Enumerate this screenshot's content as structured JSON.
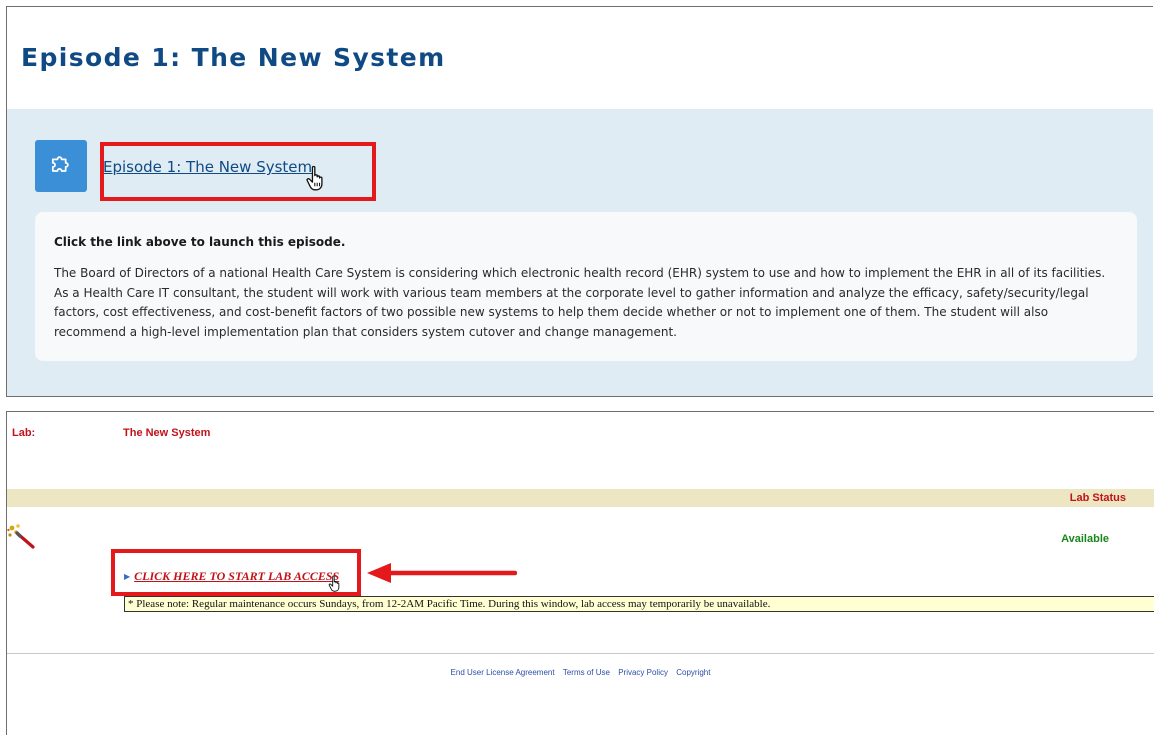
{
  "episode": {
    "title": "Episode 1: The New System",
    "activity_link": "Episode 1: The New System",
    "icon": "puzzle-icon",
    "instruction": "Click the link above to launch this episode.",
    "description": "The Board of Directors of a national Health Care System is considering which electronic health record (EHR) system to use and how to implement the EHR in all of its facilities. As a Health Care IT consultant, the student will work with various team members at the corporate level to gather information and analyze the efficacy, safety/security/legal factors, cost effectiveness, and cost-benefit factors of two possible new systems to help them decide whether or not to implement one of them. The student will also recommend a high-level implementation plan that considers system cutover and change management."
  },
  "lab": {
    "label": "Lab:",
    "name": "The New System",
    "status_header": "Lab Status",
    "status_value": "Available",
    "icon": "magic-wand-icon",
    "start_link": "CLICK HERE TO START LAB ACCESS",
    "note": "* Please note: Regular maintenance occurs Sundays, from 12-2AM Pacific Time. During this window, lab access may temporarily be unavailable."
  },
  "footer": {
    "links": [
      "End User License Agreement",
      "Terms of Use",
      "Privacy Policy",
      "Copyright"
    ]
  },
  "colors": {
    "title_blue": "#0f4a84",
    "icon_tile_blue": "#3a8fd6",
    "panel_bg": "#dfecf4",
    "highlight_red": "#e3191c",
    "lab_red": "#c1121a",
    "status_green": "#17861b",
    "status_bar": "#ede6c2",
    "note_bg": "#ffffd2"
  }
}
